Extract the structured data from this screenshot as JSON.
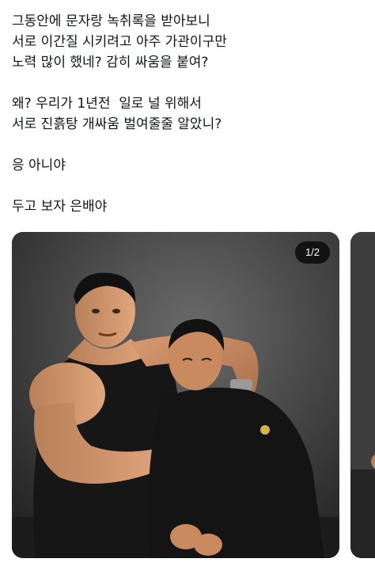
{
  "tweet": {
    "lines": [
      "그동안에 문자랑 녹취록을 받아보니",
      "서로 이간질 시키려고 아주 가관이구만",
      "노력 많이 했네? 감히 싸움을 붙여?",
      "",
      "왜? 우리가 1년전  일로 널 위해서",
      "서로 진흙탕 개싸움 벌여줄줄 알았니?",
      "",
      "응 아니야",
      "",
      "두고 보자 은배야"
    ]
  },
  "media": {
    "counter": "1/2",
    "photo_icon": "photo-icon",
    "colors": {
      "background": "#3b3b3b",
      "counter_bg": "#000000",
      "text": "#0f1419"
    }
  }
}
